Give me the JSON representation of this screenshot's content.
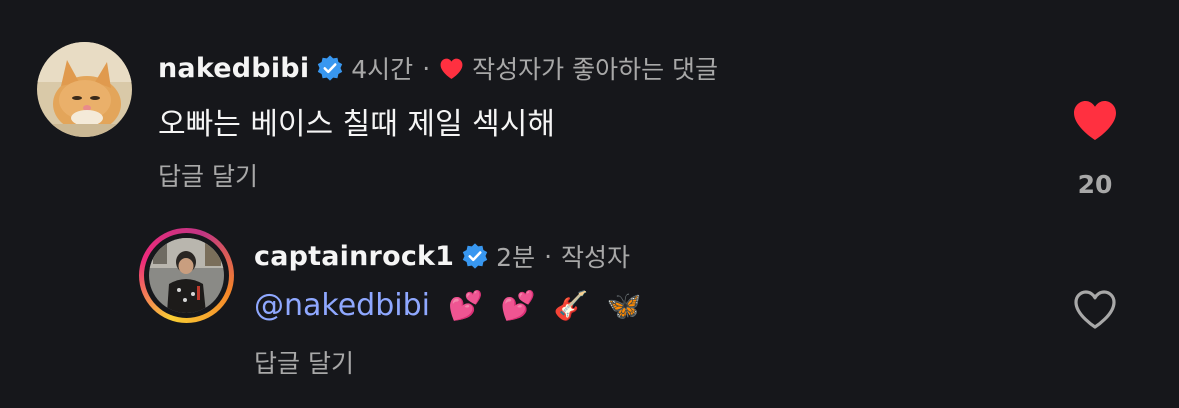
{
  "comment": {
    "username": "nakedbibi",
    "time": "4시간",
    "separator": "·",
    "liked_by_author_label": "작성자가 좋아하는 댓글",
    "text": "오빠는 베이스 칠때 제일 섹시해",
    "reply_label": "답글 달기",
    "like_count": "20",
    "liked": true
  },
  "reply": {
    "username": "captainrock1",
    "time": "2분",
    "separator": "·",
    "author_label": "작성자",
    "mention": "@nakedbibi",
    "emojis": [
      "💕",
      "💕",
      "🎸",
      "🦋"
    ],
    "reply_label": "답글 달기",
    "liked": false
  },
  "colors": {
    "background": "#16171b",
    "heart_red": "#ff3040",
    "verified_blue": "#3897f0",
    "mention_blue": "#8fa8ff",
    "muted_text": "#a8a8a8"
  },
  "icons": {
    "verified": "verified-badge-icon",
    "heart_filled": "heart-filled-icon",
    "heart_outline": "heart-outline-icon"
  }
}
